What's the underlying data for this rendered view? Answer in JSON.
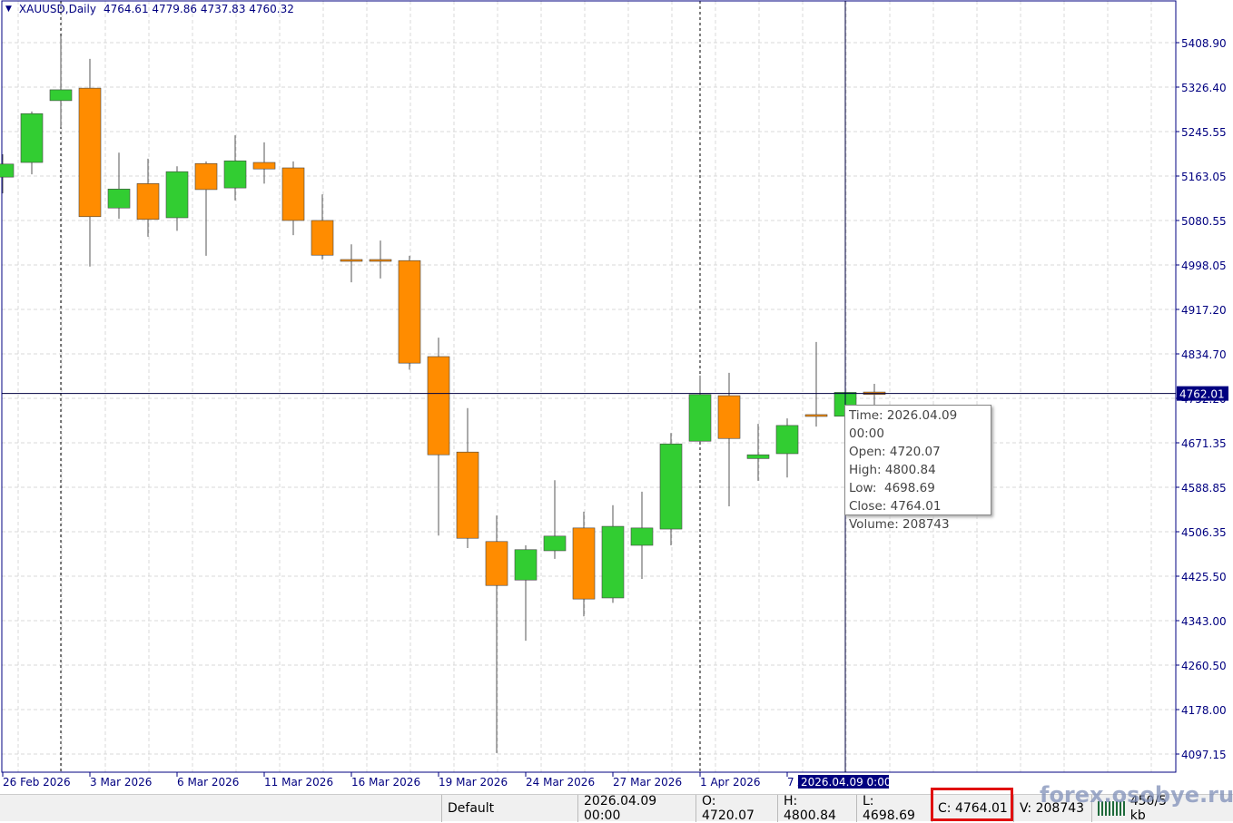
{
  "header": {
    "symbol": "XAUUSD,Daily",
    "ohlc": "4764.61 4779.86 4737.83 4760.32"
  },
  "tooltip": {
    "time": "Time: 2026.04.09 00:00",
    "open": "Open: 4720.07",
    "high": "High: 4800.84",
    "low": "Low:  4698.69",
    "close": "Close: 4764.01",
    "volume": "Volume: 208743"
  },
  "crosshair": {
    "price_label": "4762.01",
    "time_label": "2026.04.09 0:00",
    "price": 4762.01
  },
  "status": {
    "profile": "Default",
    "time": "2026.04.09 00:00",
    "open": "O: 4720.07",
    "high": "H: 4800.84",
    "low": "L: 4698.69",
    "close": "C: 4764.01",
    "volume": "V: 208743",
    "traffic": "450/5 kb"
  },
  "watermark": "forex.osobye.ru",
  "colors": {
    "bull": "#32cd32",
    "bear": "#ff8c00",
    "axis": "#000080"
  },
  "chart_data": {
    "type": "candlestick",
    "title": "XAUUSD,Daily",
    "ylim": [
      4097.15,
      5408.9
    ],
    "y_ticks": [
      "5408.90",
      "5326.40",
      "5245.55",
      "5163.05",
      "5080.55",
      "4998.05",
      "4917.20",
      "4834.70",
      "4752.20",
      "4671.35",
      "4588.85",
      "4506.35",
      "4425.50",
      "4343.00",
      "4260.50",
      "4178.00",
      "4097.15"
    ],
    "x_ticks": [
      "26 Feb 2026",
      "3 Mar 2026",
      "6 Mar 2026",
      "11 Mar 2026",
      "16 Mar 2026",
      "19 Mar 2026",
      "24 Mar 2026",
      "27 Mar 2026",
      "1 Apr 2026",
      "7 Apr 2026"
    ],
    "candles": [
      [
        5161,
        5203,
        5131,
        5185
      ],
      [
        5188,
        5282,
        5166,
        5278
      ],
      [
        5302,
        5421,
        5253,
        5322
      ],
      [
        5325,
        5379,
        4996,
        5088
      ],
      [
        5104,
        5206,
        5084,
        5139
      ],
      [
        5149,
        5195,
        5051,
        5083
      ],
      [
        5086,
        5181,
        5062,
        5171
      ],
      [
        5186,
        5190,
        5016,
        5138
      ],
      [
        5141,
        5238,
        5118,
        5191
      ],
      [
        5188,
        5225,
        5149,
        5176
      ],
      [
        5178,
        5190,
        5054,
        5081
      ],
      [
        5081,
        5129,
        5009,
        5017
      ],
      [
        5009,
        5037,
        4967,
        5006
      ],
      [
        5009,
        5044,
        4974,
        5006
      ],
      [
        5007,
        5016,
        4806,
        4818
      ],
      [
        4830,
        4865,
        4500,
        4649
      ],
      [
        4654,
        4735,
        4477,
        4495
      ],
      [
        4489,
        4537,
        4099,
        4408
      ],
      [
        4418,
        4482,
        4306,
        4474
      ],
      [
        4472,
        4602,
        4457,
        4499
      ],
      [
        4514,
        4544,
        4351,
        4383
      ],
      [
        4385,
        4556,
        4376,
        4517
      ],
      [
        4482,
        4581,
        4420,
        4514
      ],
      [
        4512,
        4689,
        4482,
        4669
      ],
      [
        4674,
        4795,
        4673,
        4760
      ],
      [
        4758,
        4800,
        4554,
        4679
      ],
      [
        4642,
        4706,
        4601,
        4649
      ],
      [
        4651,
        4716,
        4607,
        4703
      ],
      [
        4723,
        4857,
        4701,
        4720
      ],
      [
        4720.07,
        4800.84,
        4698.69,
        4764.01
      ],
      [
        4764.61,
        4779.86,
        4737.83,
        4760.32
      ]
    ]
  }
}
